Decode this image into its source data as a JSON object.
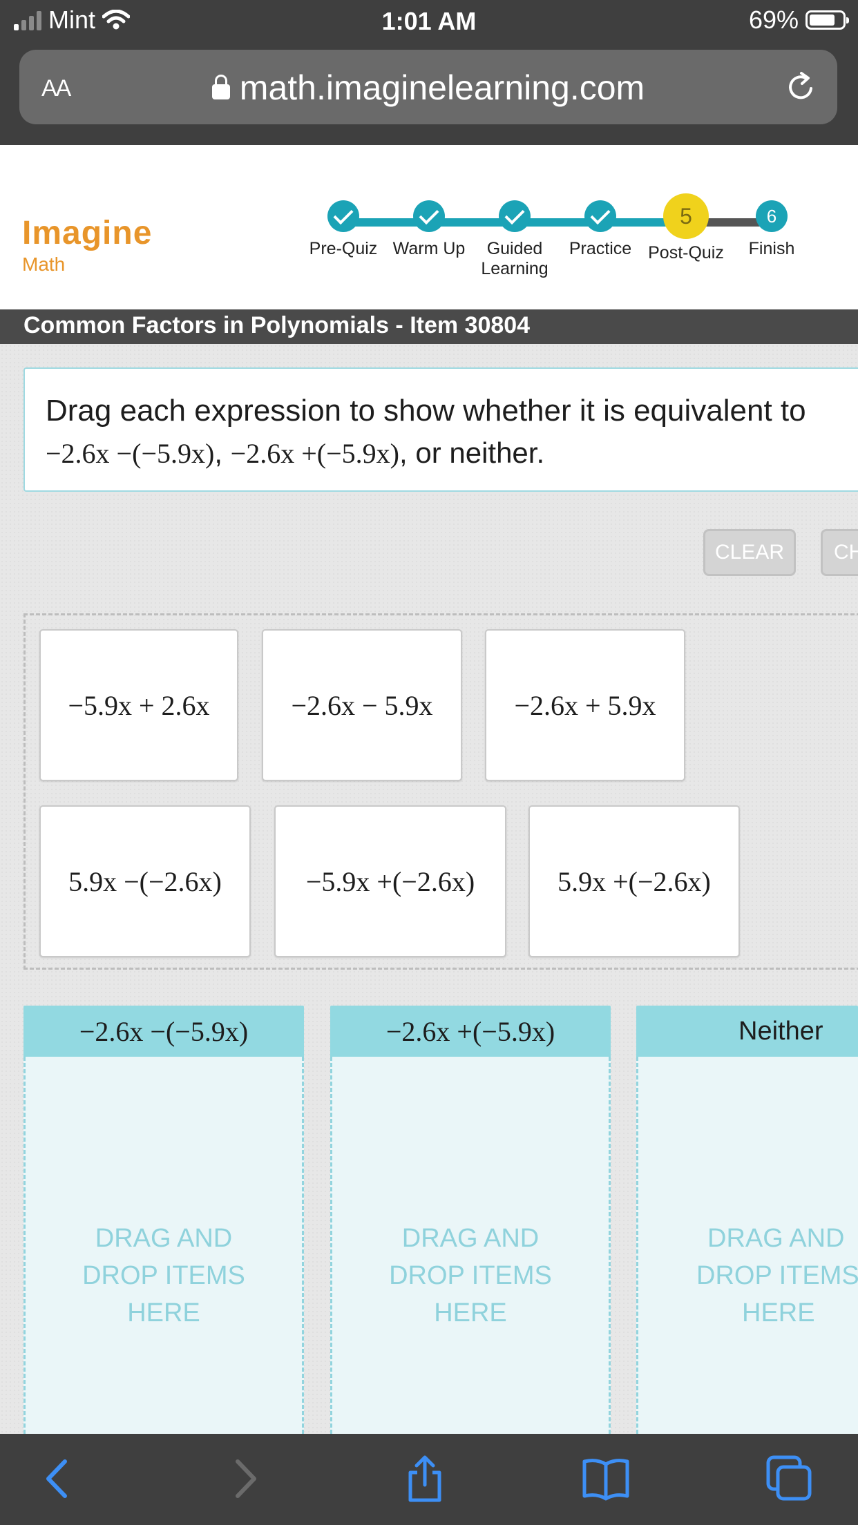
{
  "status_bar": {
    "carrier": "Mint",
    "time": "1:01 AM",
    "battery": "69%"
  },
  "browser": {
    "text_size_label": "AA",
    "url": "math.imaginelearning.com"
  },
  "logo": {
    "brand": "Imagine",
    "product": "Math"
  },
  "progress": {
    "steps": [
      {
        "label": "Pre-Quiz",
        "state": "complete"
      },
      {
        "label": "Warm Up",
        "state": "complete"
      },
      {
        "label": "Guided Learning",
        "state": "complete"
      },
      {
        "label": "Practice",
        "state": "complete"
      },
      {
        "label": "Post-Quiz",
        "state": "current",
        "number": "5"
      },
      {
        "label": "Finish",
        "state": "upcoming",
        "number": "6"
      }
    ]
  },
  "page_title": "Common Factors in Polynomials - Item 30804",
  "prompt": {
    "line1": "Drag each expression to show whether it is equivalent to",
    "expr_a": "−2.6x −(−5.9x)",
    "sep1": ", ",
    "expr_b": "−2.6x +(−5.9x)",
    "tail": ", or neither."
  },
  "buttons": {
    "clear": "CLEAR",
    "check": "CH"
  },
  "tiles": [
    "−5.9x + 2.6x",
    "−2.6x − 5.9x",
    "−2.6x + 5.9x",
    "5.9x −(−2.6x)",
    "−5.9x +(−2.6x)",
    "5.9x +(−2.6x)"
  ],
  "zones": [
    {
      "header": "−2.6x −(−5.9x)",
      "hint": [
        "DRAG AND",
        "DROP ITEMS",
        "HERE"
      ]
    },
    {
      "header": "−2.6x +(−5.9x)",
      "hint": [
        "DRAG AND",
        "DROP ITEMS",
        "HERE"
      ]
    },
    {
      "header": "Neither",
      "hint": [
        "DRAG AND",
        "DROP ITEMS",
        "HERE"
      ]
    }
  ],
  "colors": {
    "teal": "#1ba3b6",
    "current_step": "#f0d21c",
    "brand_orange": "#e8952a",
    "zone_header": "#92d9e1",
    "ios_blue": "#3d8ff5"
  }
}
